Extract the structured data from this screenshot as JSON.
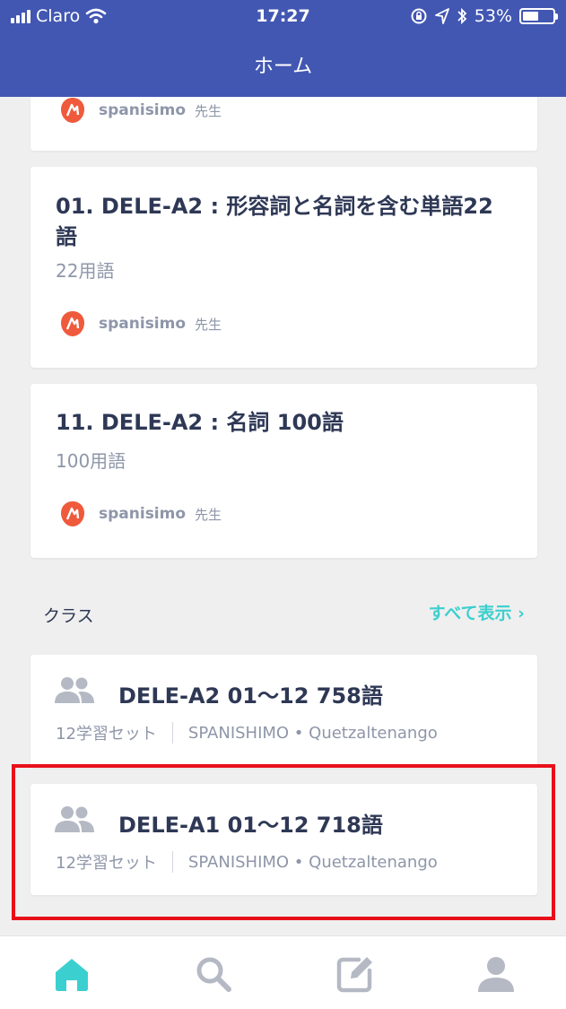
{
  "status_bar": {
    "carrier": "Claro",
    "time": "17:27",
    "battery": "53%",
    "battery_level": 0.53
  },
  "header": {
    "title": "ホーム"
  },
  "sets": [
    {
      "author": "spanisimo",
      "author_badge": "先生"
    },
    {
      "title": "01. DELE-A2 : 形容詞と名詞を含む単語22語",
      "terms": "22用語",
      "author": "spanisimo",
      "author_badge": "先生"
    },
    {
      "title": "11. DELE-A2 : 名詞 100語",
      "terms": "100用語",
      "author": "spanisimo",
      "author_badge": "先生"
    }
  ],
  "classes_section": {
    "title": "クラス",
    "see_all": "すべて表示 ›"
  },
  "classes": [
    {
      "title": "DELE-A2 01〜12 758語",
      "sets_count": "12学習セット",
      "school": "SPANISHIMO • Quetzaltenango"
    },
    {
      "title": "DELE-A1 01〜12 718語",
      "sets_count": "12学習セット",
      "school": "SPANISHIMO • Quetzaltenango"
    }
  ],
  "tabbar": {
    "items": [
      {
        "icon": "home-icon",
        "active": true
      },
      {
        "icon": "search-icon",
        "active": false
      },
      {
        "icon": "create-icon",
        "active": false
      },
      {
        "icon": "profile-icon",
        "active": false
      }
    ]
  },
  "colors": {
    "header": "#4257b2",
    "accent": "#3ccfcf",
    "tab_inactive": "#b5b9c4",
    "logo": "#ef5a3c",
    "highlight": "#e8101a"
  }
}
